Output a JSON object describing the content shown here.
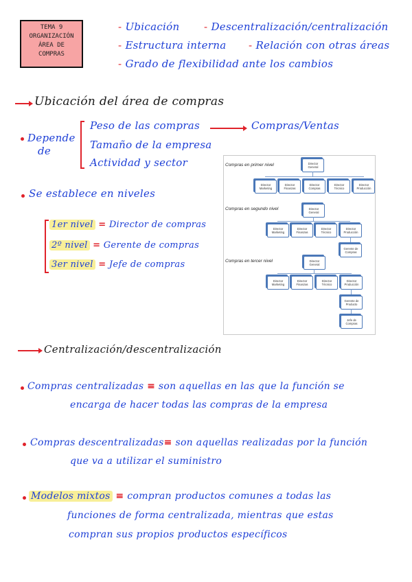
{
  "header": {
    "title_box": [
      "TEMA 9",
      "ORGANIZACIÓN",
      "ÁREA DE",
      "COMPRAS"
    ],
    "topics": [
      "Ubicación",
      "Descentralización/centralización",
      "Estructura interna",
      "Relación con otras áreas",
      "Grado de flexibilidad ante los cambios"
    ]
  },
  "section1": {
    "heading": "Ubicación del área de compras",
    "depends_label": [
      "Depende",
      "de"
    ],
    "factors": [
      "Peso de las compras",
      "Tamaño de la empresa",
      "Actividad y sector"
    ],
    "factor_result": "Compras/Ventas",
    "levels_intro": "Se establece en niveles",
    "levels": [
      {
        "level": "1er nivel",
        "role": "Director de compras"
      },
      {
        "level": "2º nivel",
        "role": "Gerente de compras"
      },
      {
        "level": "3er nivel",
        "role": "Jefe de compras"
      }
    ],
    "org_chart": {
      "level1": {
        "label": "Compras en primer nivel",
        "top": "Director General",
        "children": [
          "Director Marketing",
          "Director Finanzas",
          "Director Compras",
          "Director Técnico",
          "Director Producción"
        ]
      },
      "level2": {
        "label": "Compras en segundo nivel",
        "top": "Director General",
        "children": [
          "Director Marketing",
          "Director Finanzas",
          "Director Técnico",
          "Director Producción"
        ],
        "sub": [
          "Gerente de Compras"
        ]
      },
      "level3": {
        "label": "Compras en tercer nivel",
        "top": "Director General",
        "children": [
          "Director Marketing",
          "Director Finanzas",
          "Director Técnico",
          "Director Producción"
        ],
        "sub": [
          "Gerente de Producto",
          "Jefe de Compras"
        ]
      }
    }
  },
  "section2": {
    "heading": "Centralización/descentralización",
    "items": [
      {
        "term": "Compras centralizadas",
        "lines": [
          "son aquellas en las que la función se",
          "encarga de hacer todas las compras de la empresa"
        ]
      },
      {
        "term": "Compras descentralizadas",
        "lines": [
          "son aquellas realizadas por la función",
          "que va a utilizar el suministro"
        ]
      },
      {
        "term": "Modelos mixtos",
        "lines": [
          "compran productos comunes a todas las",
          "funciones de forma centralizada, mientras que estas",
          "compran sus propios productos específicos"
        ]
      }
    ]
  }
}
